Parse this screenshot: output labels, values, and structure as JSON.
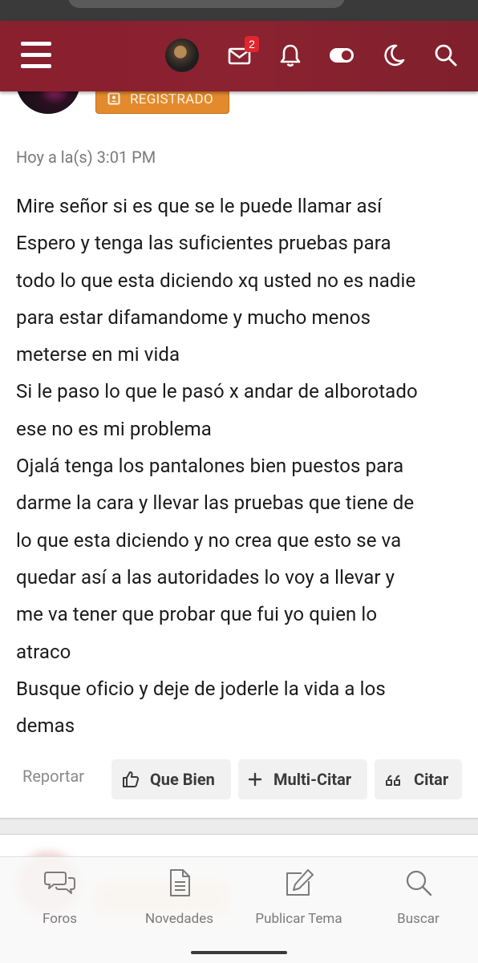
{
  "header": {
    "notifications_count": "2",
    "brand_color": "#8a1f2e",
    "icons": [
      "menu-icon",
      "avatar",
      "mail-icon",
      "bell-icon",
      "toggle-icon",
      "moon-icon",
      "search-icon"
    ]
  },
  "profile": {
    "role_badge": "REGISTRADO"
  },
  "post": {
    "timestamp": "Hoy a la(s) 3:01 PM",
    "lines": [
      "Mire señor si es que se le puede llamar así",
      "Espero y tenga las suficientes pruebas para",
      "todo lo que esta diciendo xq usted no es nadie",
      "para estar difamandome y mucho menos",
      "meterse en mi vida",
      "Si le paso lo que le pasó x andar de alborotado",
      "ese no es mi problema",
      "Ojalá tenga los pantalones bien puestos para",
      "darme la cara y llevar las pruebas que tiene de",
      "lo que esta diciendo y no crea que esto se va",
      "quedar así a las autoridades lo voy a llevar y",
      "me va tener que probar que fui yo quien lo",
      "atraco",
      "Busque oficio y deje de joderle la vida a los",
      "demas"
    ],
    "actions": {
      "report": "Reportar",
      "like": "Que Bien",
      "multi_quote": "Multi-Citar",
      "quote": "Citar"
    }
  },
  "bottom_nav": {
    "items": [
      {
        "label": "Foros",
        "icon": "chat-bubbles-icon"
      },
      {
        "label": "Novedades",
        "icon": "document-icon"
      },
      {
        "label": "Publicar Tema",
        "icon": "edit-icon"
      },
      {
        "label": "Buscar",
        "icon": "search-icon"
      }
    ]
  }
}
